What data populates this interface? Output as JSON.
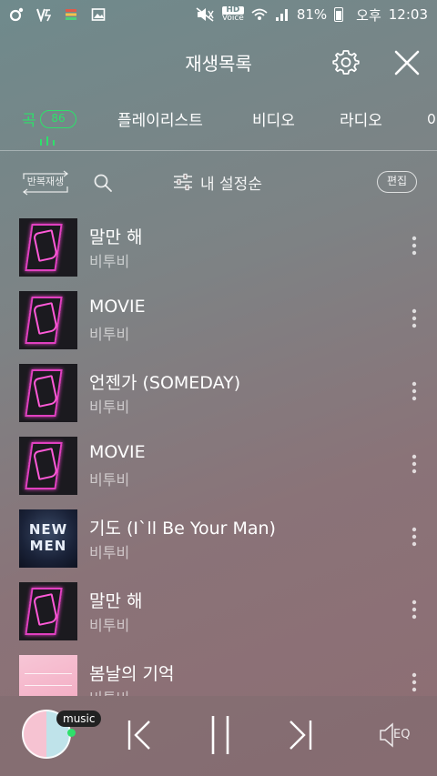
{
  "status_bar": {
    "battery_percent": "81%",
    "ampm": "오후",
    "time": "12:03",
    "hd_label": "HD",
    "voice_label": "Voice"
  },
  "header": {
    "title": "재생목록"
  },
  "tabs": [
    {
      "label": "곡",
      "active": true,
      "count": "86"
    },
    {
      "label": "플레이리스트"
    },
    {
      "label": "비디오"
    },
    {
      "label": "라디오"
    },
    {
      "label": "아"
    }
  ],
  "toolbar": {
    "repeat_label": "반복재생",
    "sort_label": "내 설정순",
    "edit_label": "편집"
  },
  "songs": [
    {
      "title": "말만 해",
      "artist": "비투비",
      "art": "neon"
    },
    {
      "title": "MOVIE",
      "artist": "비투비",
      "art": "neon"
    },
    {
      "title": "언젠가 (SOMEDAY)",
      "artist": "비투비",
      "art": "neon"
    },
    {
      "title": "MOVIE",
      "artist": "비투비",
      "art": "neon"
    },
    {
      "title": "기도 (I`ll Be Your Man)",
      "artist": "비투비",
      "art": "newmen",
      "art_text": [
        "NEW",
        "MEN"
      ]
    },
    {
      "title": "말만 해",
      "artist": "비투비",
      "art": "neon"
    },
    {
      "title": "봄날의 기억",
      "artist": "비투비",
      "art": "pink"
    }
  ],
  "player": {
    "badge": "music",
    "eq_label": "EQ"
  },
  "colors": {
    "accent": "#2ee06b"
  }
}
